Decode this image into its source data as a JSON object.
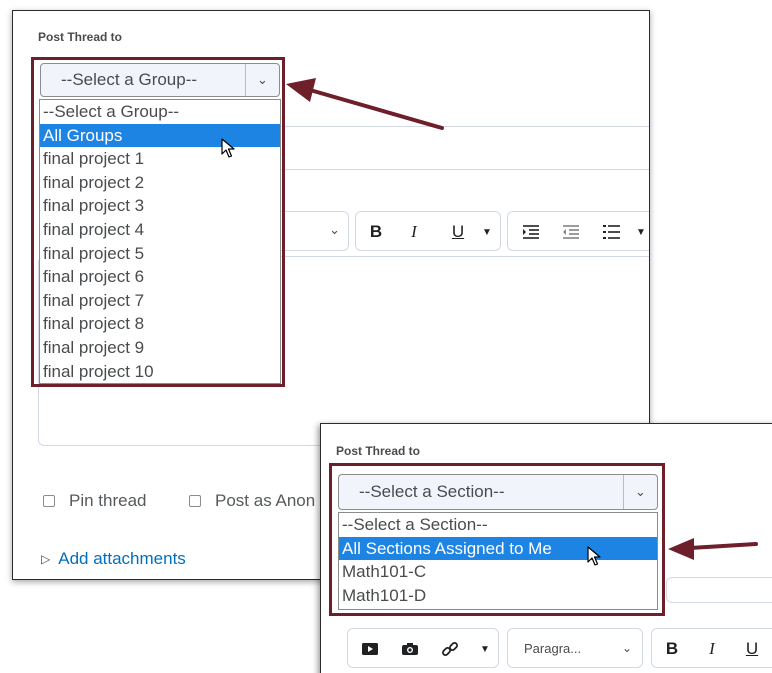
{
  "group_panel": {
    "label": "Post Thread to",
    "select_value": "--Select a Group--",
    "options": [
      "--Select a Group--",
      "All Groups",
      "final project 1",
      "final project 2",
      "final project 3",
      "final project 4",
      "final project 5",
      "final project 6",
      "final project 7",
      "final project 8",
      "final project 9",
      "final project 10"
    ],
    "selected_index": 1,
    "toolbar": {
      "bold": "B",
      "italic": "I",
      "underline": "U"
    },
    "pin_thread": "Pin thread",
    "post_as_anon": "Post as Anon",
    "add_attachments": "Add attachments"
  },
  "section_panel": {
    "label": "Post Thread to",
    "select_value": "--Select a Section--",
    "options": [
      "--Select a Section--",
      "All Sections Assigned to Me",
      "Math101-C",
      "Math101-D"
    ],
    "selected_index": 1,
    "paragraph_value": "Paragra...",
    "toolbar": {
      "bold": "B",
      "italic": "I",
      "underline": "U"
    }
  },
  "colors": {
    "highlight": "#1e84e4",
    "callout": "#6d1f2a",
    "link": "#006fbf"
  },
  "icons": [
    "chevron-down-icon",
    "caret-down-icon",
    "indent-icon",
    "outdent-icon",
    "list-icon",
    "video-icon",
    "camera-icon",
    "link-icon",
    "mouse-pointer-icon",
    "arrow-annotation-icon",
    "triangle-right-icon"
  ]
}
